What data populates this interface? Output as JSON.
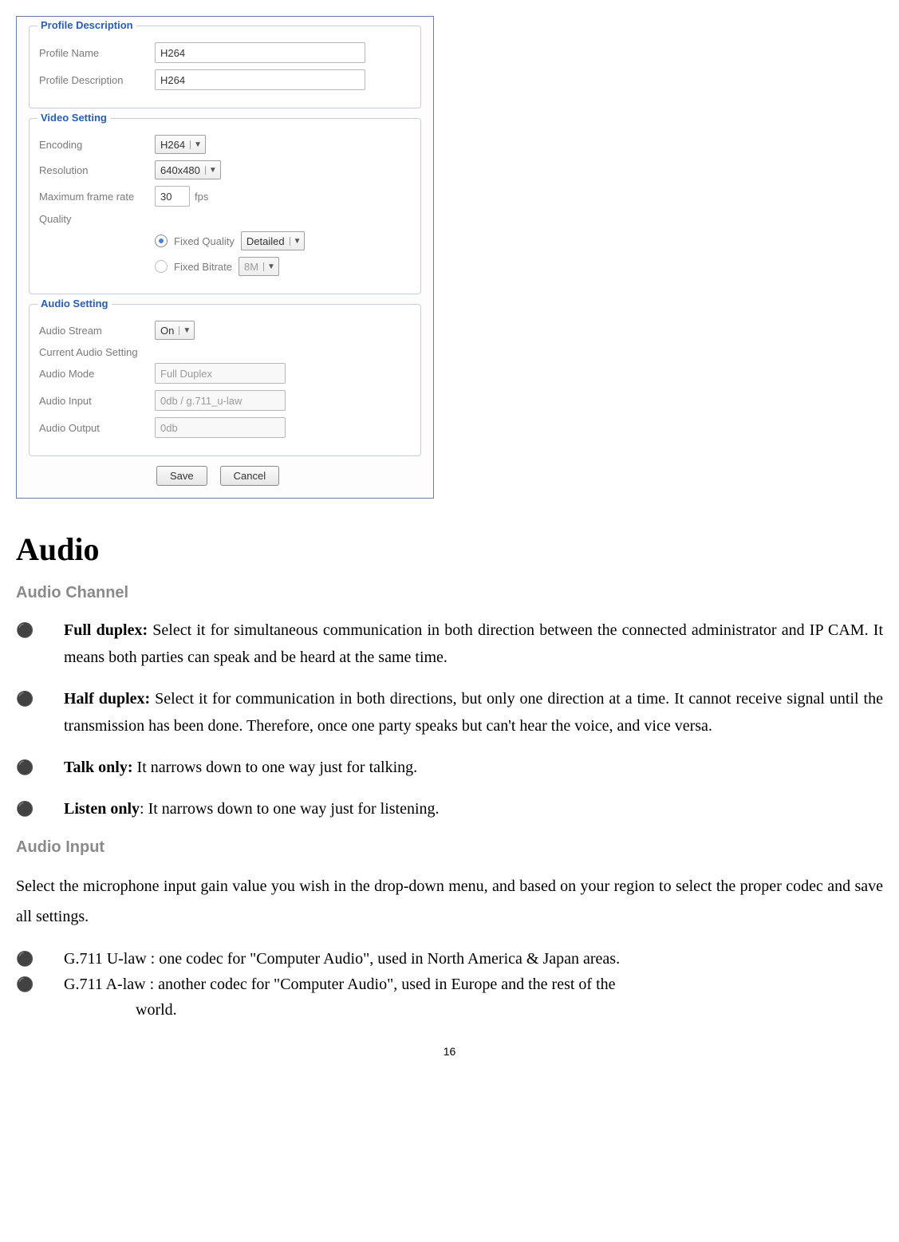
{
  "panel": {
    "profile_desc": {
      "legend": "Profile Description",
      "name_label": "Profile Name",
      "name_value": "H264",
      "desc_label": "Profile Description",
      "desc_value": "H264"
    },
    "video": {
      "legend": "Video Setting",
      "encoding_label": "Encoding",
      "encoding_value": "H264",
      "resolution_label": "Resolution",
      "resolution_value": "640x480",
      "max_frame_label": "Maximum frame rate",
      "max_frame_value": "30",
      "fps_unit": "fps",
      "quality_label": "Quality",
      "fixed_quality_label": "Fixed Quality",
      "fixed_quality_value": "Detailed",
      "fixed_bitrate_label": "Fixed Bitrate",
      "fixed_bitrate_value": "8M"
    },
    "audio": {
      "legend": "Audio Setting",
      "stream_label": "Audio Stream",
      "stream_value": "On",
      "current_label": "Current Audio Setting",
      "mode_label": "Audio Mode",
      "mode_value": "Full Duplex",
      "input_label": "Audio Input",
      "input_value": "0db / g.711_u-law",
      "output_label": "Audio Output",
      "output_value": "0db"
    },
    "buttons": {
      "save": "Save",
      "cancel": "Cancel"
    }
  },
  "doc": {
    "h1": "Audio",
    "h2_channel": "Audio Channel",
    "bullets_channel": [
      {
        "bold": "Full duplex:",
        "text": " Select it for simultaneous communication in both direction between the connected administrator and IP CAM. It means both parties can speak and be heard at the same time."
      },
      {
        "bold": "Half duplex:",
        "text": " Select it for communication in both directions, but only one direction at a time. It cannot receive signal until the transmission has been done. Therefore, once one party speaks but can't hear the voice, and vice versa."
      },
      {
        "bold": "Talk only:",
        "text": " It narrows down to one way just for talking."
      },
      {
        "bold": "Listen only",
        "text": ": It narrows down to one way just for listening."
      }
    ],
    "h2_input": "Audio Input",
    "input_para": "Select the microphone input gain value you wish in the drop-down menu, and based on your region to select the proper codec and save all settings.",
    "bullets_input": [
      "G.711 U-law : one codec for \"Computer Audio\", used in North America & Japan areas.",
      "G.711 A-law : another codec for \"Computer Audio\", used in Europe and the rest of the"
    ],
    "input_continue": "world.",
    "page_number": "16"
  }
}
